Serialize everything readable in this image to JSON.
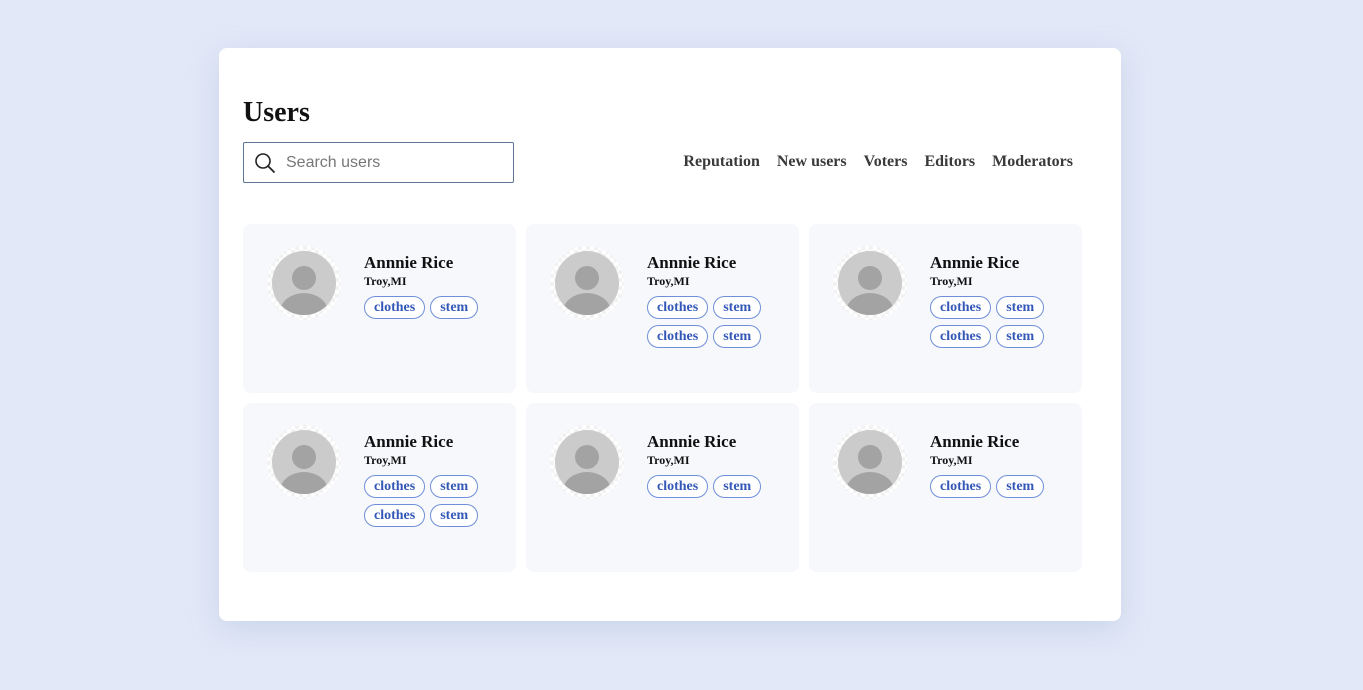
{
  "page": {
    "title": "Users"
  },
  "search": {
    "placeholder": "Search users",
    "value": ""
  },
  "filters": [
    "Reputation",
    "New users",
    "Voters",
    "Editors",
    "Moderators"
  ],
  "users": [
    {
      "name": "Annnie Rice",
      "location": "Troy,MI",
      "tags": [
        "clothes",
        "stem"
      ]
    },
    {
      "name": "Annnie Rice",
      "location": "Troy,MI",
      "tags": [
        "clothes",
        "stem",
        "clothes",
        "stem"
      ]
    },
    {
      "name": "Annnie Rice",
      "location": "Troy,MI",
      "tags": [
        "clothes",
        "stem",
        "clothes",
        "stem"
      ]
    },
    {
      "name": "Annnie Rice",
      "location": "Troy,MI",
      "tags": [
        "clothes",
        "stem",
        "clothes",
        "stem"
      ]
    },
    {
      "name": "Annnie Rice",
      "location": "Troy,MI",
      "tags": [
        "clothes",
        "stem"
      ]
    },
    {
      "name": "Annnie Rice",
      "location": "Troy,MI",
      "tags": [
        "clothes",
        "stem"
      ]
    }
  ],
  "colors": {
    "background": "#e2e8f7",
    "panel": "#ffffff",
    "card": "#f6f8fc",
    "tag_text": "#3458b8",
    "tag_border": "#6f8fd8"
  },
  "icons": {
    "search": "search-icon",
    "avatar": "user-avatar-placeholder-icon"
  }
}
